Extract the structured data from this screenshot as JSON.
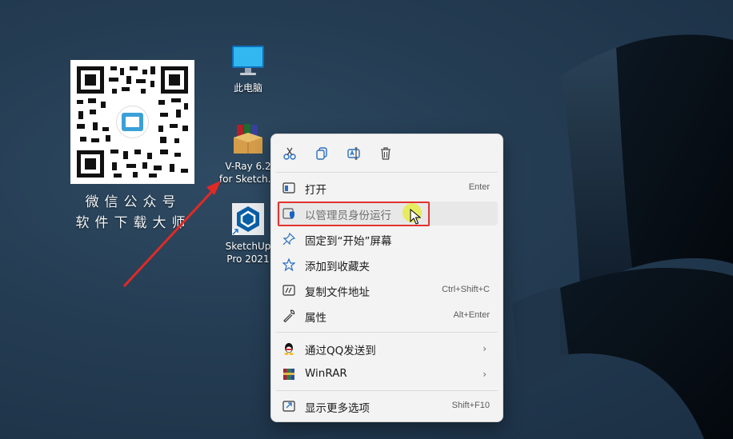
{
  "colors": {
    "highlight_border": "#e2332e",
    "menu_bg": "#f3f3f3",
    "cursor_glow": "#e6eb46"
  },
  "qr": {
    "caption_line1": "微信公众号",
    "caption_line2": "软件下载大师"
  },
  "desktop_icons": [
    {
      "name": "this-pc",
      "label_line1": "此电脑",
      "label_line2": ""
    },
    {
      "name": "vray",
      "label_line1": "V-Ray 6.2",
      "label_line2": "for Sketch..."
    },
    {
      "name": "sketchup",
      "label_line1": "SketchUp",
      "label_line2": "Pro 2021"
    }
  ],
  "menu": {
    "toolbar": [
      {
        "icon": "cut-icon"
      },
      {
        "icon": "copy-icon"
      },
      {
        "icon": "rename-icon"
      },
      {
        "icon": "delete-icon"
      }
    ],
    "items": [
      {
        "label": "打开",
        "shortcut": "Enter",
        "icon": "open-icon"
      },
      {
        "label": "以管理员身份运行",
        "shortcut": "",
        "icon": "shield-icon"
      },
      {
        "label": "固定到“开始”屏幕",
        "shortcut": "",
        "icon": "pin-icon"
      },
      {
        "label": "添加到收藏夹",
        "shortcut": "",
        "icon": "star-icon"
      },
      {
        "label": "复制文件地址",
        "shortcut": "Ctrl+Shift+C",
        "icon": "copy-path-icon"
      },
      {
        "label": "属性",
        "shortcut": "Alt+Enter",
        "icon": "wrench-icon"
      },
      {
        "label": "通过QQ发送到",
        "shortcut": "",
        "icon": "qq-icon",
        "submenu": "›"
      },
      {
        "label": "WinRAR",
        "shortcut": "",
        "icon": "winrar-icon",
        "submenu": "›"
      },
      {
        "label": "显示更多选项",
        "shortcut": "Shift+F10",
        "icon": "more-options-icon"
      }
    ]
  }
}
